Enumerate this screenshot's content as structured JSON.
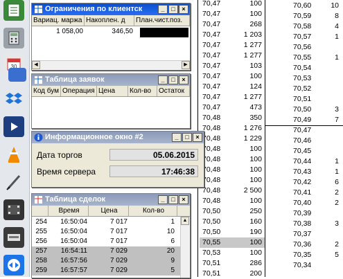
{
  "quotes": {
    "left_rows": [
      [
        "70,47",
        "100"
      ],
      [
        "70,47",
        "100"
      ],
      [
        "70,47",
        "268"
      ],
      [
        "70,47",
        "1 203"
      ],
      [
        "70,47",
        "1 277"
      ],
      [
        "70,47",
        "1 277"
      ],
      [
        "70,47",
        "103"
      ],
      [
        "70,47",
        "100"
      ],
      [
        "70,47",
        "124"
      ],
      [
        "70,47",
        "1 277"
      ],
      [
        "70,47",
        "473"
      ],
      [
        "70,48",
        "350"
      ],
      [
        "70,48",
        "1 276"
      ],
      [
        "70,48",
        "1 229"
      ],
      [
        "70,48",
        "100"
      ],
      [
        "70,48",
        "100"
      ],
      [
        "70,48",
        "100"
      ],
      [
        "70,48",
        "100"
      ],
      [
        "70,48",
        "2 500"
      ],
      [
        "70,48",
        "100"
      ],
      [
        "70,50",
        "250"
      ],
      [
        "70,50",
        "160"
      ],
      [
        "70,50",
        "190"
      ],
      [
        "70,55",
        "100"
      ],
      [
        "70,53",
        "100"
      ],
      [
        "70,51",
        "286"
      ],
      [
        "70,51",
        "200"
      ]
    ],
    "right_rows": [
      [
        "70,60",
        "10"
      ],
      [
        "70,59",
        "8"
      ],
      [
        "70,58",
        "4"
      ],
      [
        "70,57",
        "1"
      ],
      [
        "70,56",
        ""
      ],
      [
        "70,55",
        "1"
      ],
      [
        "70,54",
        ""
      ],
      [
        "70,53",
        ""
      ],
      [
        "70,52",
        ""
      ],
      [
        "70,51",
        ""
      ],
      [
        "70,50",
        "3"
      ],
      [
        "70,49",
        "7"
      ],
      [
        "70,47",
        ""
      ],
      [
        "70,46",
        ""
      ],
      [
        "70,45",
        ""
      ],
      [
        "70,44",
        "1"
      ],
      [
        "70,43",
        "1"
      ],
      [
        "70,42",
        "6"
      ],
      [
        "70,41",
        "2"
      ],
      [
        "70,40",
        "2"
      ],
      [
        "70,39",
        ""
      ],
      [
        "70,38",
        "3"
      ],
      [
        "70,37",
        ""
      ],
      [
        "70,36",
        "2"
      ],
      [
        "70,35",
        "5"
      ],
      [
        "70,34",
        ""
      ]
    ]
  },
  "client_limits": {
    "title": "Ограничения по клиентск",
    "headers": [
      "Вариац. маржа",
      "Накоплен. д",
      "План.чист.поз."
    ],
    "row": [
      "1 058,00",
      "346,50",
      ""
    ]
  },
  "orders": {
    "title": "Таблица заявок",
    "headers": [
      "Код бум",
      "Операция",
      "Цена",
      "Кол-во",
      "Остаток"
    ]
  },
  "info": {
    "title": "Информационное окно #2",
    "trade_date_label": "Дата торгов",
    "trade_date_value": "05.06.2015",
    "server_time_label": "Время сервера",
    "server_time_value": "17:46:38"
  },
  "deals": {
    "title": "Таблица сделок",
    "headers": [
      "Время",
      "Цена",
      "Кол-во"
    ],
    "rows": [
      [
        "254",
        "16:50:04",
        "7 017",
        "1"
      ],
      [
        "255",
        "16:50:04",
        "7 017",
        "10"
      ],
      [
        "256",
        "16:50:04",
        "7 017",
        "6"
      ],
      [
        "257",
        "16:54:11",
        "7 029",
        "20"
      ],
      [
        "258",
        "16:57:56",
        "7 029",
        "9"
      ],
      [
        "259",
        "16:57:57",
        "7 029",
        "5"
      ]
    ]
  },
  "colors": {
    "title_active": "#0a4fd0",
    "title_inactive": "#8b9ab8",
    "highlight_row": "#c0c0c0"
  },
  "dock_icons": [
    "spreadsheet-icon",
    "calculator-icon",
    "calendar-icon",
    "network-icon",
    "dropbox-icon",
    "media-player-icon",
    "vlc-icon",
    "pen-icon",
    "film-icon",
    "scanner-icon",
    "teamviewer-icon"
  ]
}
